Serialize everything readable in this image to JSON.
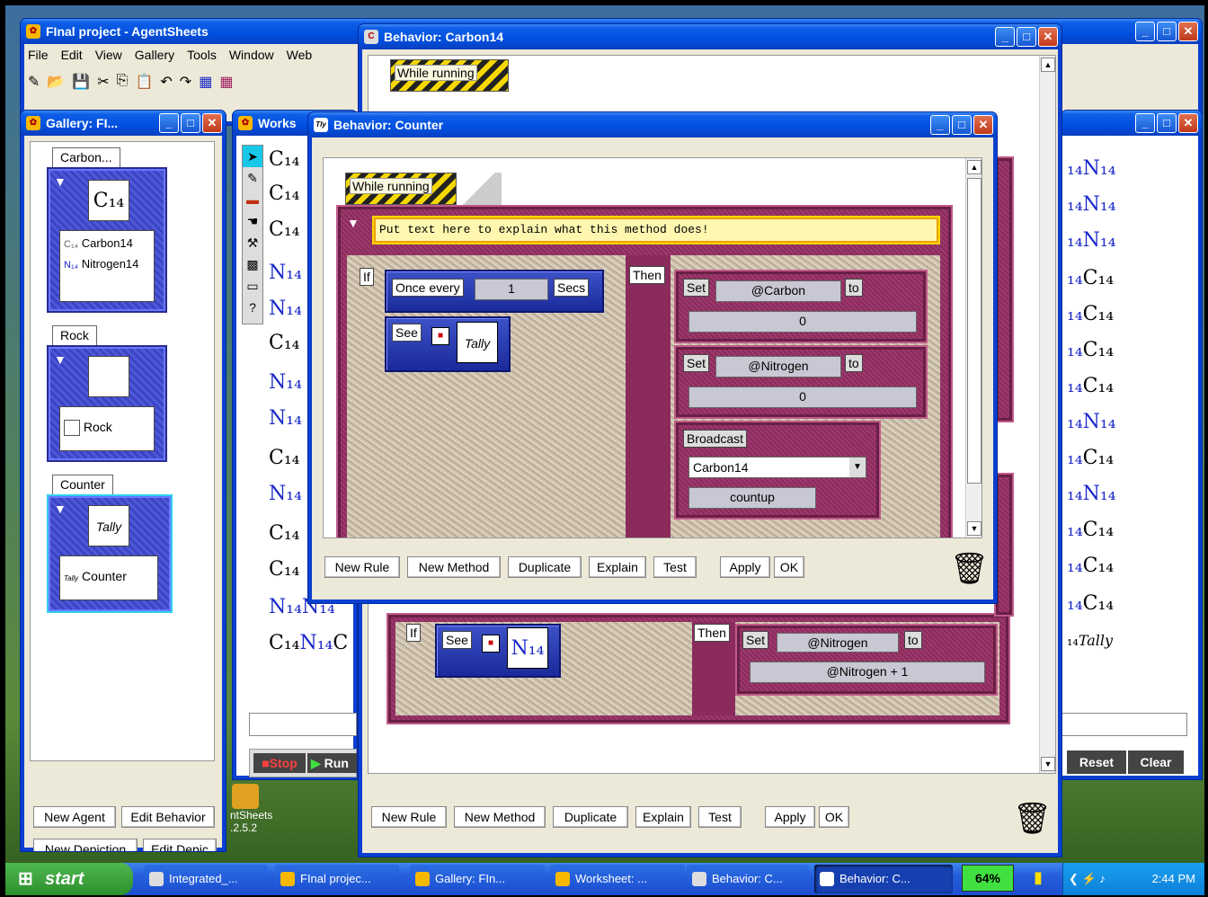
{
  "main_window": {
    "title": "FInal project  -  AgentSheets",
    "menu": [
      "File",
      "Edit",
      "View",
      "Gallery",
      "Tools",
      "Window",
      "Web"
    ]
  },
  "gallery": {
    "title": "Gallery: FI...",
    "agents": [
      {
        "tab": "Carbon...",
        "glyph": "C₁₄",
        "entries": [
          {
            "icon": "C₁₄",
            "label": "Carbon14"
          },
          {
            "icon": "N₁₄",
            "label": "Nitrogen14"
          }
        ]
      },
      {
        "tab": "Rock",
        "entries": [
          {
            "label": "Rock"
          }
        ]
      },
      {
        "tab": "Counter",
        "glyph": "Tally",
        "entries": [
          {
            "icon": "Tally",
            "label": "Counter"
          }
        ]
      }
    ],
    "buttons": {
      "new_agent": "New Agent",
      "edit_behavior": "Edit Behavior",
      "new_depiction": "New Depiction",
      "edit_depiction": "Edit Depic"
    }
  },
  "worksheet": {
    "title": "Works",
    "stop": "Stop",
    "run": "Run",
    "reset": "Reset",
    "clear": "Clear",
    "right_title": ""
  },
  "behavior_carbon": {
    "title": "Behavior: Carbon14",
    "trigger": "While running",
    "if": "If",
    "then": "Then",
    "see": "See",
    "set": "Set",
    "var": "@Nitrogen",
    "to": "to",
    "expr": "@Nitrogen + 1",
    "buttons": {
      "new_rule": "New Rule",
      "new_method": "New Method",
      "duplicate": "Duplicate",
      "explain": "Explain",
      "test": "Test",
      "apply": "Apply",
      "ok": "OK"
    }
  },
  "behavior_counter": {
    "title": "Behavior: Counter",
    "trigger": "While running",
    "comment": "Put text here to explain what this method does!",
    "if": "If",
    "then": "Then",
    "once_every": "Once every",
    "interval": "1",
    "secs": "Secs",
    "see": "See",
    "tally": "Tally",
    "set1": {
      "set": "Set",
      "var": "@Carbon",
      "to": "to",
      "value": "0"
    },
    "set2": {
      "set": "Set",
      "var": "@Nitrogen",
      "to": "to",
      "value": "0"
    },
    "broadcast": {
      "label": "Broadcast",
      "agent": "Carbon14",
      "method": "countup"
    },
    "buttons": {
      "new_rule": "New Rule",
      "new_method": "New Method",
      "duplicate": "Duplicate",
      "explain": "Explain",
      "test": "Test",
      "apply": "Apply",
      "ok": "OK"
    }
  },
  "desktop": {
    "icon_label": "ntSheets",
    "version": ".2.5.2"
  },
  "taskbar": {
    "start": "start",
    "items": [
      "Integrated_...",
      "FInal projec...",
      "Gallery: FIn...",
      "Worksheet: ...",
      "Behavior: C...",
      "Behavior: C..."
    ],
    "battery": "64%",
    "clock": "2:44 PM"
  },
  "colors": {
    "titlebar": "#0054e3",
    "maroon": "#8a2b5c",
    "agent_blue": "#3b44c4"
  }
}
